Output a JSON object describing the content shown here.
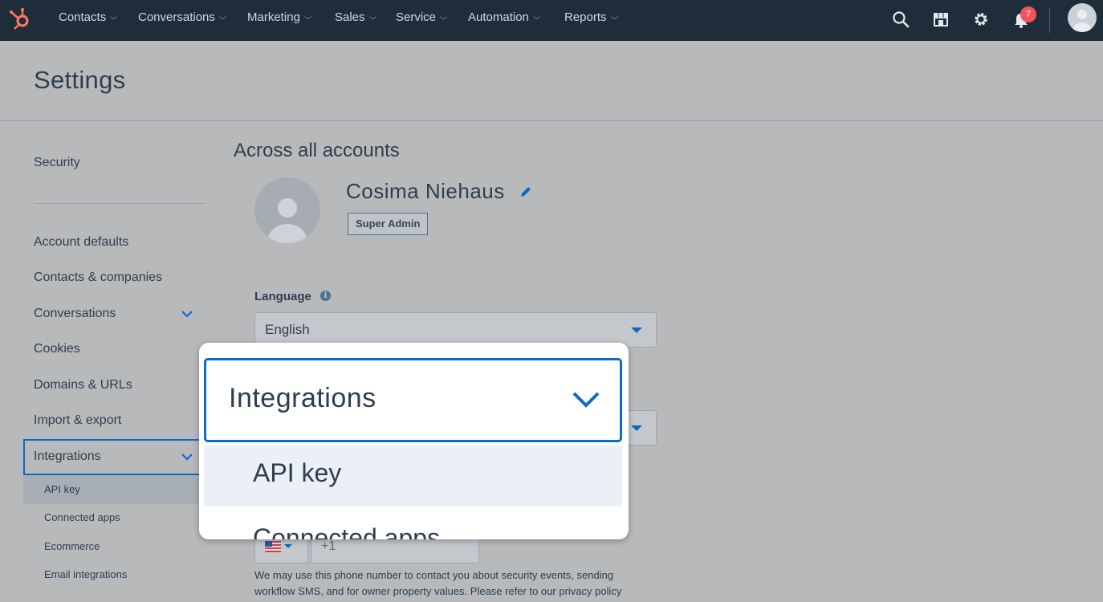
{
  "topnav": {
    "items": [
      {
        "label": "Contacts"
      },
      {
        "label": "Conversations"
      },
      {
        "label": "Marketing"
      },
      {
        "label": "Sales"
      },
      {
        "label": "Service"
      },
      {
        "label": "Automation"
      },
      {
        "label": "Reports"
      }
    ],
    "notification_count": "7"
  },
  "page": {
    "title": "Settings"
  },
  "sidebar": {
    "security_label": "Security",
    "items": [
      {
        "label": "Account defaults"
      },
      {
        "label": "Contacts & companies"
      },
      {
        "label": "Conversations"
      },
      {
        "label": "Cookies"
      },
      {
        "label": "Domains & URLs"
      },
      {
        "label": "Import & export"
      },
      {
        "label": "Integrations"
      }
    ],
    "subitems": [
      {
        "label": "API key"
      },
      {
        "label": "Connected apps"
      },
      {
        "label": "Ecommerce"
      },
      {
        "label": "Email integrations"
      }
    ]
  },
  "main": {
    "section_title": "Across all accounts",
    "user_name": "Cosima Niehaus",
    "role_badge": "Super Admin",
    "language_label": "Language",
    "language_value": "English",
    "phone_prefix": "+1",
    "help_text": "We may use this phone number to contact you about security events, sending workflow SMS, and for owner property values. Please refer to our privacy policy"
  },
  "popover": {
    "header": "Integrations",
    "active_item": "API key",
    "next_item": "Connected apps"
  },
  "colors": {
    "accent": "#0b6cc7",
    "nav_bg": "#1f2d3b",
    "badge": "#f2545b",
    "brand": "#ff7a59"
  }
}
